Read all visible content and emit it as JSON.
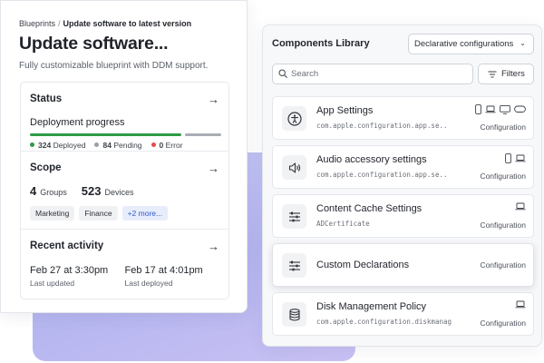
{
  "breadcrumb": {
    "root": "Blueprints",
    "separator": "/",
    "current": "Update software to latest version"
  },
  "page": {
    "title": "Update software...",
    "subtitle": "Fully customizable blueprint with DDM support."
  },
  "status": {
    "title": "Status",
    "progress_label": "Deployment progress",
    "deployed_fraction": 0.79,
    "legend": [
      {
        "count": "324",
        "label": "Deployed",
        "color": "#2e9b47"
      },
      {
        "count": "84",
        "label": "Pending",
        "color": "#9a9ea5"
      },
      {
        "count": "0",
        "label": "Error",
        "color": "#e5484d"
      }
    ]
  },
  "scope": {
    "title": "Scope",
    "groups_count": "4",
    "groups_label": "Groups",
    "devices_count": "523",
    "devices_label": "Devices",
    "tags": [
      "Marketing",
      "Finance"
    ],
    "more_label": "+2 more..."
  },
  "activity": {
    "title": "Recent activity",
    "entries": [
      {
        "value": "Feb 27 at 3:30pm",
        "label": "Last updated"
      },
      {
        "value": "Feb 17 at 4:01pm",
        "label": "Last deployed"
      }
    ]
  },
  "library": {
    "title": "Components Library",
    "select_value": "Declarative configurations",
    "search_placeholder": "Search",
    "filters_label": "Filters",
    "items": [
      {
        "name": "App Settings",
        "id": "com.apple.configuration.app.se..",
        "type": "Configuration",
        "icon": "accessibility-icon",
        "devices": [
          "phone",
          "laptop",
          "desktop",
          "vision"
        ]
      },
      {
        "name": "Audio accessory settings",
        "id": "com.apple.configuration.app.se..",
        "type": "Configuration",
        "icon": "speaker-icon",
        "devices": [
          "phone",
          "laptop"
        ]
      },
      {
        "name": "Content Cache Settings",
        "id": "ADCertificate",
        "type": "Configuration",
        "icon": "sliders-icon",
        "devices": [
          "laptop"
        ]
      },
      {
        "name": "Custom Declarations",
        "id": "",
        "type": "Configuration",
        "icon": "sliders-icon",
        "devices": []
      },
      {
        "name": "Disk Management Policy",
        "id": "com.apple.configuration.diskmanag...",
        "type": "Configuration",
        "icon": "database-icon",
        "devices": [
          "laptop"
        ]
      }
    ]
  }
}
